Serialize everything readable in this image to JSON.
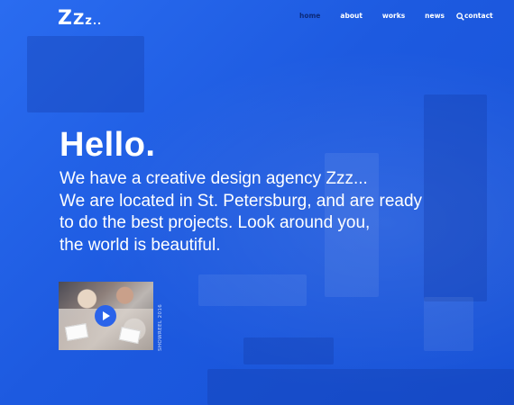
{
  "logo": {
    "z1": "Z",
    "z2": "Z",
    "z3": "z",
    "dots": ".."
  },
  "nav": {
    "items": [
      {
        "label": "home",
        "active": true
      },
      {
        "label": "about",
        "active": false
      },
      {
        "label": "works",
        "active": false
      },
      {
        "label": "news",
        "active": false
      },
      {
        "label": "contact",
        "active": false
      }
    ],
    "search_icon": "search-icon"
  },
  "hero": {
    "heading": "Hello.",
    "lines": [
      "We have a creative design agency Zzz...",
      "We are located in St. Petersburg, and are ready",
      "to do the best projects. Look around you,",
      "the world is beautiful."
    ]
  },
  "video": {
    "caption": "SHOWREEL 2016",
    "play_icon": "play-icon"
  },
  "colors": {
    "background": "#1f5de0",
    "nav_active": "#0c2a7a",
    "text": "#ffffff",
    "play_button": "#2a63ea"
  }
}
